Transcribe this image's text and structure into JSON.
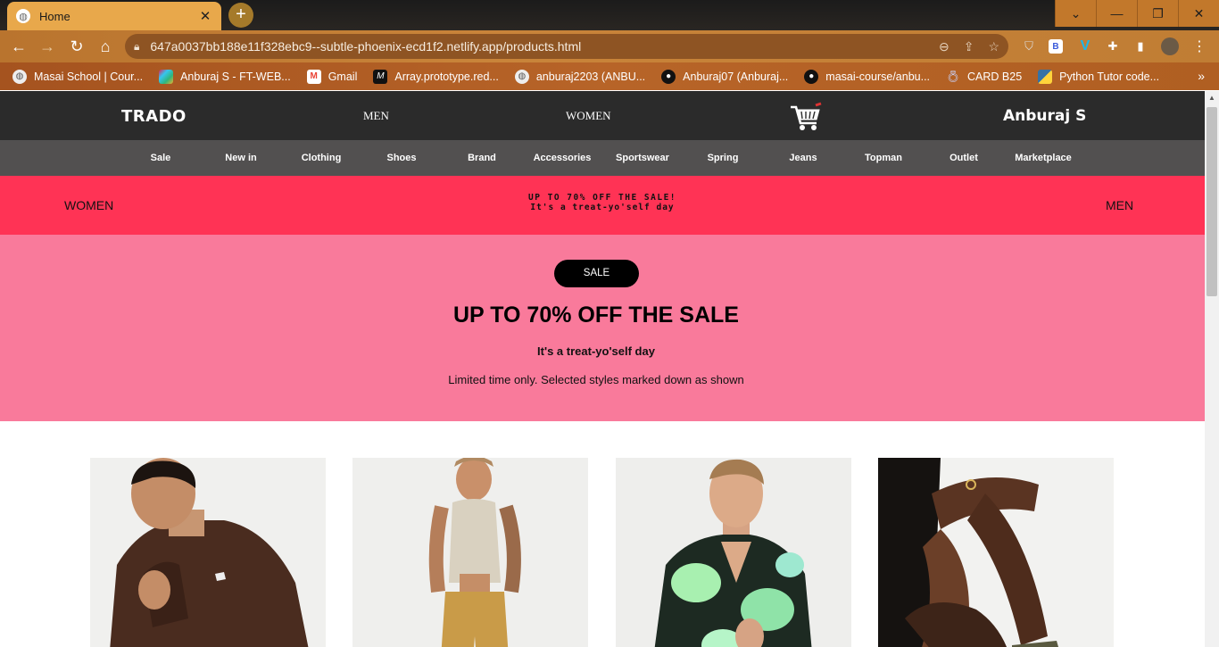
{
  "browser": {
    "tab_title": "Home",
    "tab_close": "✕",
    "new_tab": "+",
    "url": "647a0037bb188e11f328ebc9--subtle-phoenix-ecd1f2.netlify.app/products.html",
    "window_controls": [
      "⌄",
      "—",
      "❐",
      "✕"
    ],
    "bookmarks": [
      {
        "label": "Masai School | Cour...",
        "icon": "globe-icon",
        "color": "#ffffff"
      },
      {
        "label": "Anburaj S - FT-WEB...",
        "icon": "slack-icon",
        "color": "#e01e5a"
      },
      {
        "label": "Gmail",
        "icon": "gmail-icon",
        "color": "#ea4335"
      },
      {
        "label": "Array.prototype.red...",
        "icon": "mdn-icon",
        "color": "#111111"
      },
      {
        "label": "anburaj2203 (ANBU...",
        "icon": "globe-icon",
        "color": "#ffffff"
      },
      {
        "label": "Anburaj07 (Anburaj...",
        "icon": "github-icon",
        "color": "#111111"
      },
      {
        "label": "masai-course/anbu...",
        "icon": "github-icon",
        "color": "#111111"
      },
      {
        "label": "CARD B25",
        "icon": "ring-icon",
        "color": "#6a7cc9"
      },
      {
        "label": "Python Tutor code...",
        "icon": "python-icon",
        "color": "#3572a5"
      }
    ],
    "bookmarks_more": "»"
  },
  "site": {
    "logo": "TRADO",
    "nav_men": "MEN",
    "nav_women": "WOMEN",
    "username": "Anburaj S",
    "categories": [
      "Sale",
      "New in",
      "Clothing",
      "Shoes",
      "Brand",
      "Accessories",
      "Sportswear",
      "Spring",
      "Jeans",
      "Topman",
      "Outlet",
      "Marketplace"
    ]
  },
  "promo_bar": {
    "left": "WOMEN",
    "line1": "UP TO 70% OFF THE SALE!",
    "line2": "It's a treat-yo'self day",
    "right": "MEN"
  },
  "hero": {
    "badge": "SALE",
    "title": "UP TO 70% OFF THE SALE",
    "subtitle": "It's a treat-yo'self day",
    "note": "Limited time only. Selected styles marked down as shown"
  },
  "colors": {
    "header_bg": "#2b2b2b",
    "catnav_bg": "#525050",
    "promo_bg": "#ff3355",
    "hero_bg": "#f97a9b",
    "tab_bg": "#e8a84b"
  },
  "products": [
    {
      "image": "man-brown-fleece-photo"
    },
    {
      "image": "man-tank-top-shorts-photo"
    },
    {
      "image": "man-floral-shirt-photo"
    },
    {
      "image": "seated-legs-photo"
    }
  ]
}
